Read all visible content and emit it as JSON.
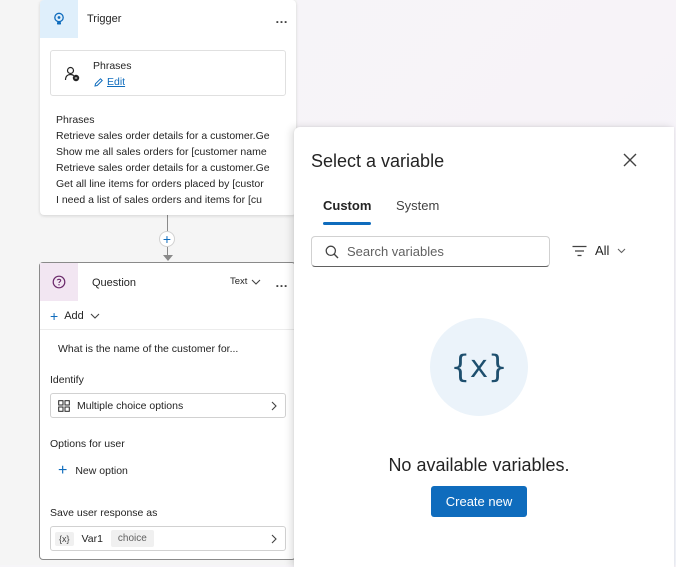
{
  "trigger": {
    "title": "Trigger",
    "more": "…",
    "phrases_box": {
      "title": "Phrases",
      "edit_label": "Edit"
    },
    "phrases_heading": "Phrases",
    "phrases": [
      "Retrieve sales order details for a customer.Ge",
      "Show me all sales orders for [customer name",
      "Retrieve sales order details for a customer.Ge",
      "Get all line items for orders placed by [custor",
      "I need a list of sales orders and items for [cu"
    ]
  },
  "question": {
    "title": "Question",
    "type_label": "Text",
    "more": "…",
    "add_label": "Add",
    "prompt_text": "What is the name of the customer for...",
    "identify_label": "Identify",
    "identify_value": "Multiple choice options",
    "options_label": "Options for user",
    "new_option_label": "New option",
    "save_label": "Save user response as",
    "var_chip": "{x}",
    "var_name": "Var1",
    "var_type": "choice"
  },
  "panel": {
    "title": "Select a variable",
    "tabs": [
      {
        "label": "Custom",
        "active": true
      },
      {
        "label": "System",
        "active": false
      }
    ],
    "search_placeholder": "Search variables",
    "filter_label": "All",
    "empty_glyph": "{x}",
    "empty_text": "No available variables.",
    "create_label": "Create new"
  },
  "colors": {
    "accent": "#0f6cbd",
    "trigger_icon_bg": "#dfeffb",
    "question_icon_bg": "#f2e6f2",
    "empty_circle_bg": "#ebf3fa"
  }
}
